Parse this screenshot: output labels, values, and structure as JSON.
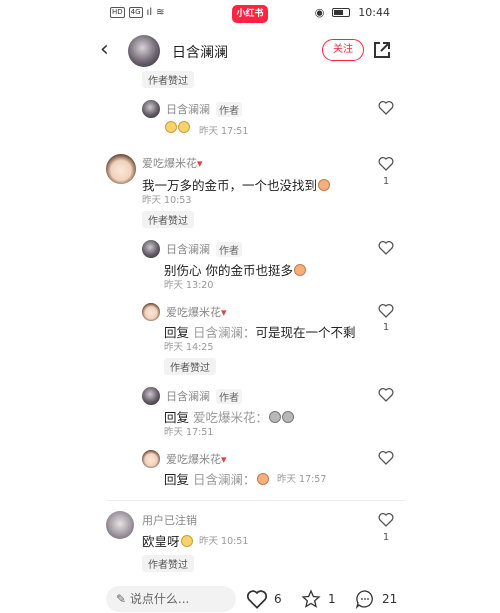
{
  "status_bar": {
    "left_labels": [
      "HD",
      "4G",
      "ıl"
    ],
    "app_badge": "小红书",
    "time": "10:44"
  },
  "header": {
    "user_name": "日含澜澜",
    "follow_label": "关注"
  },
  "comments": [
    {
      "pill": "作者赞过"
    },
    {
      "name": "日含澜澜",
      "author_tag": "作者",
      "time": "昨天 17:51"
    },
    {
      "name": "爱吃爆米花",
      "text": "我一万多的金币，一个也没找到",
      "time": "昨天 10:53",
      "likes": "1",
      "pill": "作者赞过"
    },
    {
      "name": "日含澜澜",
      "author_tag": "作者",
      "text": "别伤心 你的金币也挺多",
      "time": "昨天 13:20"
    },
    {
      "name": "爱吃爆米花",
      "reply_prefix": "回复",
      "reply_to": "日含澜澜：",
      "text": "可是现在一个不剩",
      "time": "昨天 14:25",
      "likes": "1",
      "pill": "作者赞过"
    },
    {
      "name": "日含澜澜",
      "author_tag": "作者",
      "reply_prefix": "回复",
      "reply_to": "爱吃爆米花：",
      "time": "昨天 17:51"
    },
    {
      "name": "爱吃爆米花",
      "reply_prefix": "回复",
      "reply_to": "日含澜澜：",
      "time": "昨天 17:57"
    },
    {
      "name": "用户已注销",
      "text": "欧皇呀",
      "time": "昨天 10:51",
      "likes": "1",
      "pill": "作者赞过"
    }
  ],
  "bottom_bar": {
    "input_placeholder": "说点什么...",
    "likes": "6",
    "stars": "1",
    "comments": "21"
  }
}
